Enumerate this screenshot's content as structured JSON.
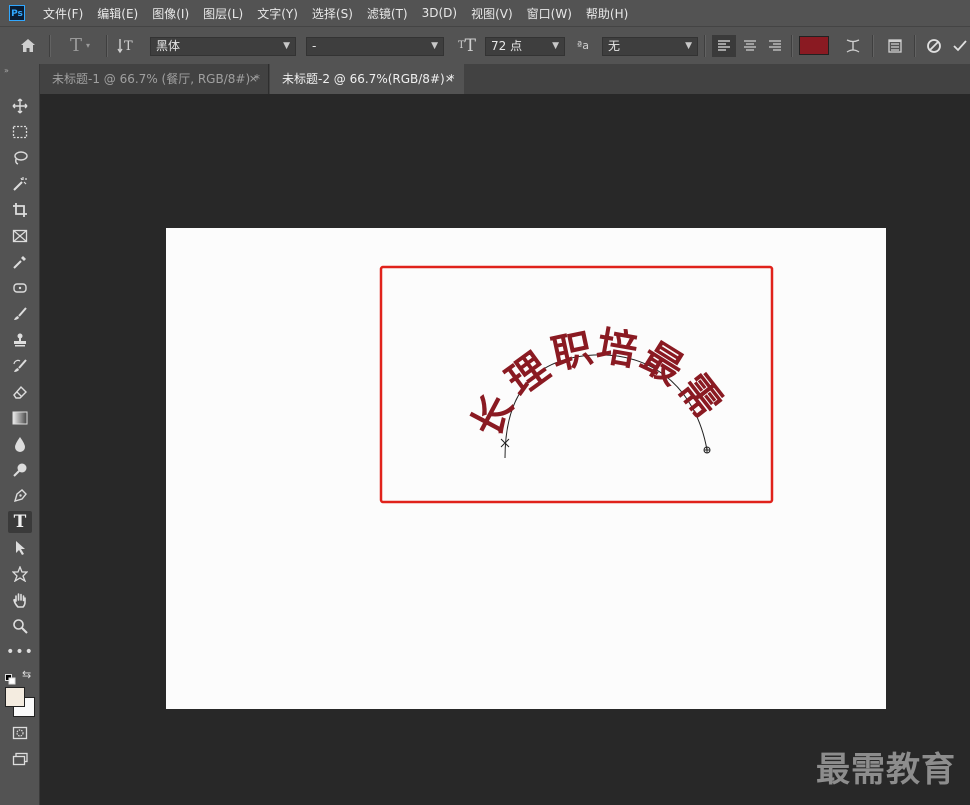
{
  "app": {
    "logo": "Ps"
  },
  "menu": [
    "文件(F)",
    "编辑(E)",
    "图像(I)",
    "图层(L)",
    "文字(Y)",
    "选择(S)",
    "滤镜(T)",
    "3D(D)",
    "视图(V)",
    "窗口(W)",
    "帮助(H)"
  ],
  "options": {
    "font_family": "黑体",
    "font_style": "-",
    "font_size": "72 点",
    "antialias_label": "ªa",
    "antialias": "无",
    "text_color": "#8a1a22"
  },
  "tabs": [
    {
      "title": "未标题-1 @ 66.7% (餐厅, RGB/8#) *",
      "close": "×"
    },
    {
      "title": "未标题-2 @ 66.7%(RGB/8#) *",
      "close": "×"
    }
  ],
  "canvas": {
    "path_text": "长理职培最需",
    "text_color": "#8a1a22",
    "highlight_color": "#e0221b"
  },
  "watermark": "最需教育",
  "icons": {
    "home": "home-icon",
    "type": "type-tool-icon",
    "orientation": "text-orientation-icon",
    "size": "font-size-icon",
    "align_left": "align-left-icon",
    "align_center": "align-center-icon",
    "align_right": "align-right-icon",
    "warp": "warp-text-icon",
    "panels": "character-panel-icon",
    "cancel": "cancel-icon",
    "commit": "commit-icon"
  }
}
